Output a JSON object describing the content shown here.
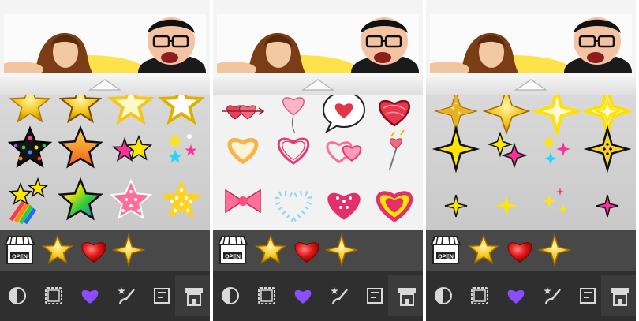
{
  "screens": [
    {
      "name": "stars",
      "grid_style": "gray",
      "stickers": [
        "star-gold-icon",
        "star-gold-outline-icon",
        "star-outline-icon",
        "star-white-outline-icon",
        "star-black-dots-icon",
        "star-orange-icon",
        "stars-pink-yellow-icon",
        "stars-sparkle-small-icon",
        "shooting-star-rainbow-icon",
        "star-rainbow-icon",
        "star-pink-dots-icon",
        "star-yellow-dots-icon"
      ]
    },
    {
      "name": "hearts",
      "grid_style": "light",
      "stickers": [
        "hearts-arrow-icon",
        "heart-balloon-icon",
        "heart-speech-bubble-icon",
        "heart-scribble-red-icon",
        "heart-outline-orange-icon",
        "heart-outline-pink-icon",
        "hearts-double-icon",
        "heart-wand-icon",
        "bow-pink-icon",
        "heart-blue-dots-icon",
        "heart-pink-dots-icon",
        "heart-yellow-pink-icon"
      ]
    },
    {
      "name": "sparkles",
      "grid_style": "gray",
      "stickers": [
        "sparkle-glitter-icon",
        "sparkle-gold-icon",
        "sparkle-glow-outline-icon",
        "sparkle-glow-double-icon",
        "sparkle-yellow-icon",
        "sparkles-yellow-pink-icon",
        "sparkles-small-colored-icon",
        "sparkle-dotted-icon",
        "sparkle-small-outline-icon",
        "sparkle-small-yellow-icon",
        "sparkles-tiny-icon",
        "sparkle-pink-small-icon"
      ]
    }
  ],
  "recent_bar": [
    "shop-open-icon",
    "star-recent-icon",
    "heart-recent-icon",
    "sparkle-recent-icon"
  ],
  "shop_sign": "OPEN",
  "toolbar": [
    "contrast-icon",
    "frame-icon",
    "heart-tool-icon",
    "brush-icon",
    "text-icon",
    "sticker-tool-icon"
  ],
  "colors": {
    "toolbar_bg": "#2f2f2f",
    "recent_bg": "#484848",
    "accent": "#8a4dff"
  }
}
